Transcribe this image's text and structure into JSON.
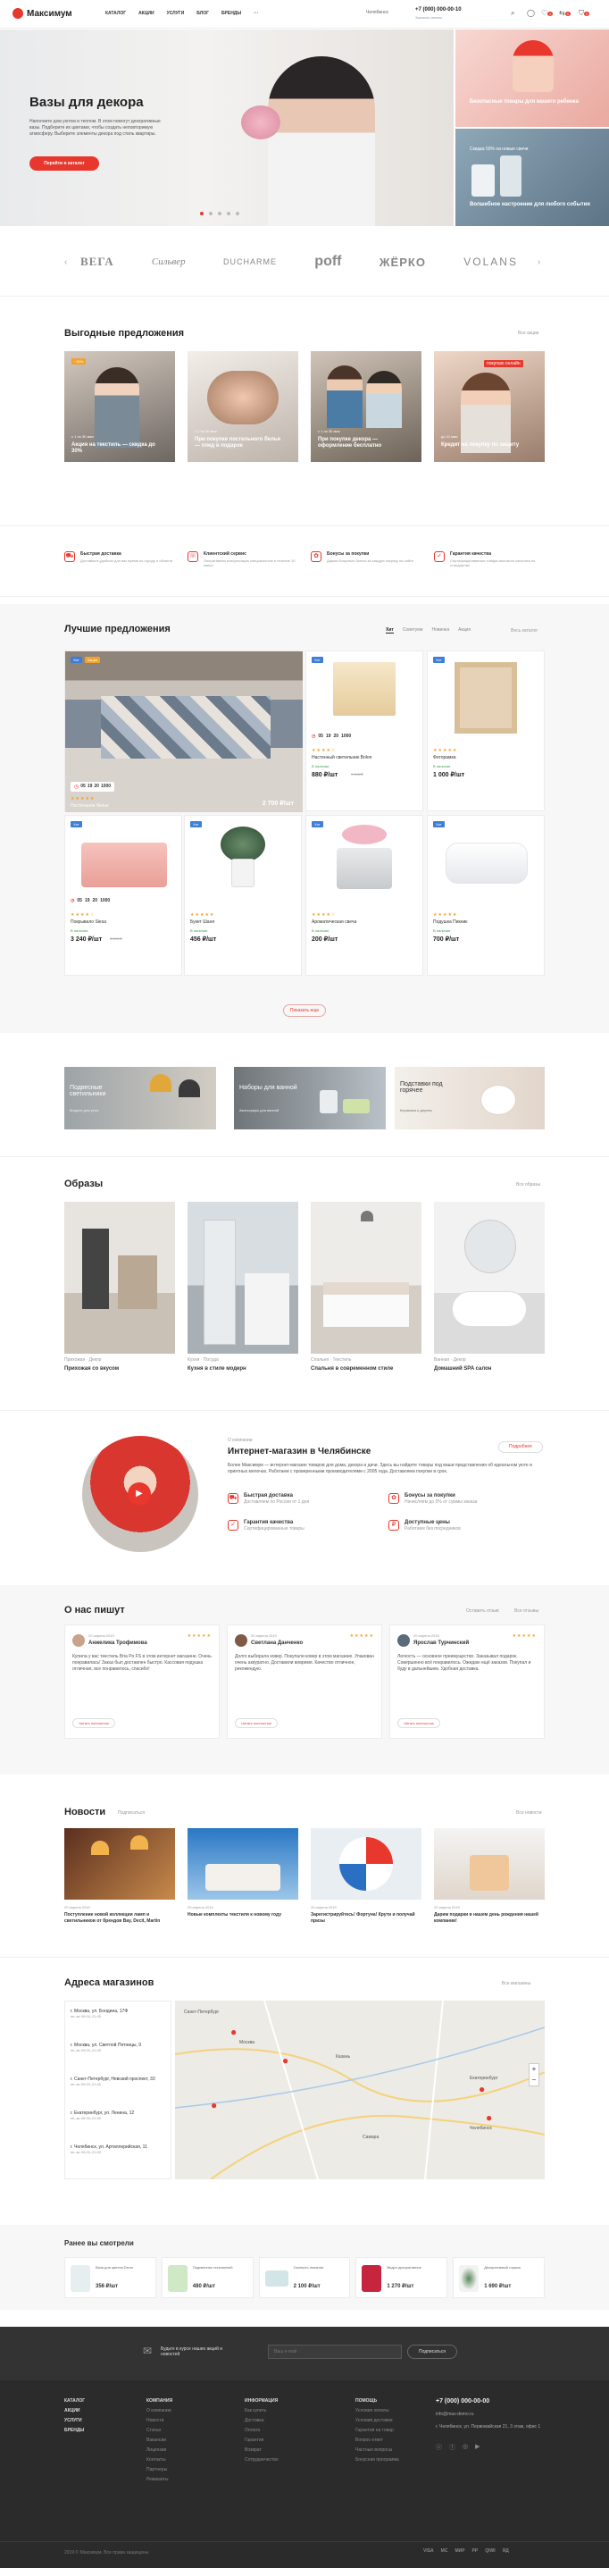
{
  "header": {
    "brand": "Максимум",
    "nav": [
      "КАТАЛОГ",
      "АКЦИИ",
      "УСЛУГИ",
      "БЛОГ",
      "БРЕНДЫ",
      "···"
    ],
    "city": "Челябинск",
    "phone": "+7 (000) 000-00-10",
    "phone_sub": "Заказать звонок",
    "counts": [
      "0",
      "0",
      "0"
    ]
  },
  "hero": {
    "title": "Вазы для декора",
    "text": "Наполните дом уютом и теплом. В этом помогут декоративные вазы. Подберите их цветами, чтобы создать неповторимую атмосферу. Выберите элементы декора под стиль квартиры.",
    "button": "Перейти в каталог",
    "side_top": "Безопасные товары для вашего ребенка",
    "side_bottom": "Волшебное настроение для любого события",
    "side_bottom_sub": "Скидка 50% на новые свечи"
  },
  "brands": [
    "ВЕГА",
    "Сильвер",
    "DUCHARME",
    "poff",
    "ЖЁРКО",
    "VOLANS"
  ],
  "offers": {
    "title": "Выгодные предложения",
    "all": "Все акции",
    "items": [
      {
        "text": "Акция на текстиль — скидка до 30%",
        "date": "с 1 по 30 мая",
        "badge": "−30%"
      },
      {
        "text": "При покупке постельного белья — плед в подарок",
        "date": "с 1 по 30 мая",
        "badge": ""
      },
      {
        "text": "При покупке декора — оформление бесплатно",
        "date": "с 1 по 30 мая",
        "badge": ""
      },
      {
        "text": "Кредит на покупку по защиту",
        "date": "до 31 мая",
        "badge": "покупаю онлайн"
      }
    ]
  },
  "benefits": [
    {
      "title": "Быстрая доставка",
      "text": "Доставка в удобное для вас время по городу и области"
    },
    {
      "title": "Клиентский сервис",
      "text": "Оперативная консультация специалистов в течение 10 минут"
    },
    {
      "title": "Бонусы за покупки",
      "text": "Дарим бонусные баллы за каждую покупку на сайте"
    },
    {
      "title": "Гарантия качества",
      "text": "Сертифицированные товары высокого качества по стандартам"
    }
  ],
  "best": {
    "title": "Лучшие предложения",
    "tabs": [
      "Хит",
      "Советуем",
      "Новинка",
      "Акция"
    ],
    "all": "Весь каталог",
    "more": "Показать еще",
    "timer": [
      "05",
      "19",
      "20",
      "1000"
    ],
    "timer_labels": [
      "дни",
      "час",
      "мин",
      "сек"
    ],
    "items": [
      {
        "name": "Постельное белье",
        "price": "2 700 ₽/шт",
        "old": "",
        "badge": "Хит",
        "badge2": "Акция"
      },
      {
        "name": "Настенный светильник Bolon",
        "price": "880 ₽/шт",
        "old": "1 100 ₽",
        "badge": "Хит",
        "badge2": ""
      },
      {
        "name": "Фоторамка",
        "price": "1 000 ₽/шт",
        "old": "",
        "badge": "Хит",
        "badge2": ""
      },
      {
        "name": "Покрывало Siesa",
        "price": "3 240 ₽/шт",
        "old": "3 600 ₽",
        "badge": "Хит",
        "badge2": ""
      },
      {
        "name": "Букет Шаня",
        "price": "456 ₽/шт",
        "old": "",
        "badge": "Хит",
        "badge2": ""
      },
      {
        "name": "Ароматическая свеча",
        "price": "200 ₽/шт",
        "old": "",
        "badge": "Хит",
        "badge2": ""
      },
      {
        "name": "Подушка Пикник",
        "price": "700 ₽/шт",
        "old": "",
        "badge": "Хит",
        "badge2": ""
      }
    ],
    "stock": "В наличии"
  },
  "promo": [
    {
      "title": "Подвесные светильники",
      "sub": "Модели для уюта"
    },
    {
      "title": "Наборы для ванной",
      "sub": "Аксессуары для ванной"
    },
    {
      "title": "Подставки под горячее",
      "sub": "Керамика и дерево"
    }
  ],
  "images": {
    "title": "Образы",
    "all": "Все образы",
    "items": [
      {
        "title": "Прихожая со вкусом",
        "tags": "Прихожая · Декор"
      },
      {
        "title": "Кухня в стиле модерн",
        "tags": "Кухня · Посуда"
      },
      {
        "title": "Спальня в современном стиле",
        "tags": "Спальня · Текстиль"
      },
      {
        "title": "Домашний SPA салон",
        "tags": "Ванная · Декор"
      }
    ]
  },
  "about": {
    "small": "О компании",
    "title": "Интернет-магазин в Челябинске",
    "button": "Подробнее",
    "text": "Более Максимум — интернет-магазин товаров для дома, декора и дачи. Здесь вы найдете товары под ваши представления об идеальном уюте и приятных мелочах. Работаем с проверенными производителями с 2005 года. Доставляем покупки в срок.",
    "features": [
      {
        "title": "Быстрая доставка",
        "text": "Доставляем по России от 1 дня"
      },
      {
        "title": "Бонусы за покупки",
        "text": "Начисляем до 5% от суммы заказа"
      },
      {
        "title": "Гарантия качества",
        "text": "Сертифицированные товары"
      },
      {
        "title": "Доступные цены",
        "text": "Работаем без посредников"
      }
    ]
  },
  "reviews": {
    "title": "О нас пишут",
    "tabs": [
      "Оставить отзыв",
      "Все отзывы"
    ],
    "items": [
      {
        "date": "20 апреля 2019",
        "name": "Анжелика Трофимова",
        "text": "Купила у вас текстиль Bria Po FS в этом интернет магазине. Очень понравилась! Заказ был доставлен быстро. Кассовая подушка отличная, все понравилось, спасибо!",
        "link": "Читать полностью"
      },
      {
        "date": "20 апреля 2019",
        "name": "Светлана Данченко",
        "text": "Долго выбирала ковер. Покупали ковер в этом магазине. Упакован очень аккуратно. Доставили вовремя. Качество отличное, рекомендую.",
        "link": "Читать полностью"
      },
      {
        "date": "20 апреля 2019",
        "name": "Ярослав Турчинский",
        "text": "Легкость — основное преимущество. Заказывал подарок. Совершенно всё понравилось. Ожидаю ещё заказов. Покупал и буду в дальнейшем. Удобная доставка.",
        "link": "Читать полностью"
      }
    ]
  },
  "news": {
    "title": "Новости",
    "sub": "Подписаться",
    "all": "Все новости",
    "items": [
      {
        "date": "20 апреля 2019",
        "text": "Поступление новой коллекции ламп и светильников от брендов Bay, Decit, Martin"
      },
      {
        "date": "20 апреля 2019",
        "text": "Новые комплекты текстиля к новому году"
      },
      {
        "date": "20 апреля 2019",
        "text": "Зарегистрируйтесь! Фортуна! Крути и получай призы"
      },
      {
        "date": "20 апреля 2019",
        "text": "Дарим подарки в нашем день рождения нашей компании!"
      }
    ]
  },
  "stores": {
    "title": "Адреса магазинов",
    "all": "Все магазины",
    "items": [
      {
        "city": "г. Москва, ул. Болдина, 17Ф",
        "hours": "пн–вс 09:00–21:00"
      },
      {
        "city": "г. Москва, ул. Светлой Пятницы, 9",
        "hours": "пн–вс 09:00–21:00"
      },
      {
        "city": "г. Санкт-Петербург, Невский проспект, 33",
        "hours": "пн–вс 09:00–21:00"
      },
      {
        "city": "г. Екатеринбург, ул. Ленина, 12",
        "hours": "пн–вс 09:00–21:00"
      },
      {
        "city": "г. Челябинск, ул. Артиллерийская, 11",
        "hours": "пн–вс 09:00–21:00"
      }
    ],
    "map_labels": [
      "Москва",
      "Казань",
      "Екатеринбург",
      "Челябинск",
      "Санкт-Петербург",
      "Самара"
    ]
  },
  "viewed": {
    "title": "Ранее вы смотрели",
    "items": [
      {
        "name": "Ваза для цветов Decor",
        "price": "356 ₽/шт"
      },
      {
        "name": "Подсвечник стеклянный",
        "price": "480 ₽/шт"
      },
      {
        "name": "Скатерть льняная",
        "price": "2 100 ₽/шт"
      },
      {
        "name": "Ведро декоративное",
        "price": "1 270 ₽/шт"
      },
      {
        "name": "Декоративный горшок",
        "price": "1 690 ₽/шт"
      }
    ]
  },
  "subscribe": {
    "text": "Будьте в курсе наших акций и новостей",
    "placeholder": "Ваш e-mail",
    "button": "Подписаться"
  },
  "footer": {
    "col1": [
      "КАТАЛОГ",
      "АКЦИИ",
      "УСЛУГИ",
      "БРЕНДЫ"
    ],
    "col2_title": "КОМПАНИЯ",
    "col2": [
      "О компании",
      "Новости",
      "Статьи",
      "Вакансии",
      "Лицензии",
      "Контакты",
      "Партнеры",
      "Реквизиты"
    ],
    "col3_title": "ИНФОРМАЦИЯ",
    "col3": [
      "Как купить",
      "Доставка",
      "Оплата",
      "Гарантия",
      "Возврат",
      "Сотрудничество"
    ],
    "col4_title": "ПОМОЩЬ",
    "col4": [
      "Условия оплаты",
      "Условия доставки",
      "Гарантия на товар",
      "Вопрос-ответ",
      "Частные вопросы",
      "Бонусная программа"
    ],
    "phone": "+7 (000) 000-00-00",
    "email": "info@max-demo.ru",
    "address": "г. Челябинск, ул. Первомайская 21, 3 этаж, офис 1",
    "copy": "2019 © Максимум. Все права защищены",
    "pay": [
      "VISA",
      "MC",
      "МИР",
      "PP",
      "QIWI",
      "ЯД"
    ]
  },
  "colors": {
    "accent": "#e8372c",
    "dark": "#2b2b2b"
  }
}
